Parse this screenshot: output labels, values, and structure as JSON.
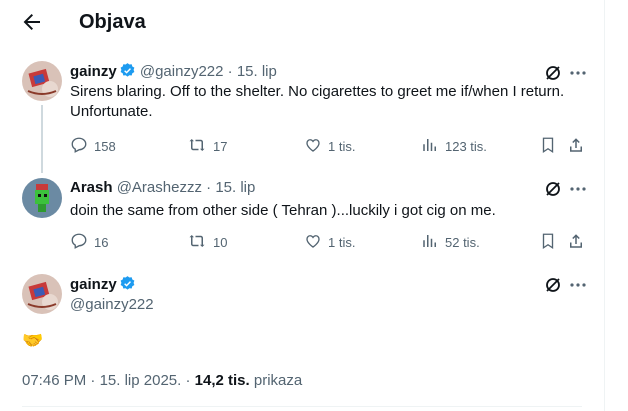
{
  "header": {
    "title": "Objava"
  },
  "tweets": [
    {
      "name": "gainzy",
      "handle": "@gainzy222",
      "sep": "·",
      "date": "15. lip",
      "text": "Sirens blaring. Off to the shelter. No cigarettes to greet me if/when I return. Unfortunate.",
      "replies": "158",
      "reposts": "17",
      "likes": "1 tis.",
      "views": "123 tis."
    },
    {
      "name": "Arash",
      "handle": "@Arashezzz",
      "sep": "·",
      "date": "15. lip",
      "text": "doin the same from other side ( Tehran )...luckily i got cig on me.",
      "replies": "16",
      "reposts": "10",
      "likes": "1 tis.",
      "views": "52 tis."
    }
  ],
  "main_tweet": {
    "name": "gainzy",
    "handle": "@gainzy222",
    "emoji": "🤝",
    "time": "07:46 PM",
    "sep1": "·",
    "date": "15. lip 2025.",
    "sep2": "·",
    "views_count": "14,2 tis.",
    "views_label": "prikaza"
  },
  "colors": {
    "verified": "#1d9bf0",
    "muted": "#536471",
    "line": "#cfd9de"
  },
  "icons": [
    "back-arrow-icon",
    "verified-badge-icon",
    "grok-icon",
    "more-icon",
    "reply-icon",
    "repost-icon",
    "like-icon",
    "views-icon",
    "bookmark-icon",
    "share-icon"
  ]
}
